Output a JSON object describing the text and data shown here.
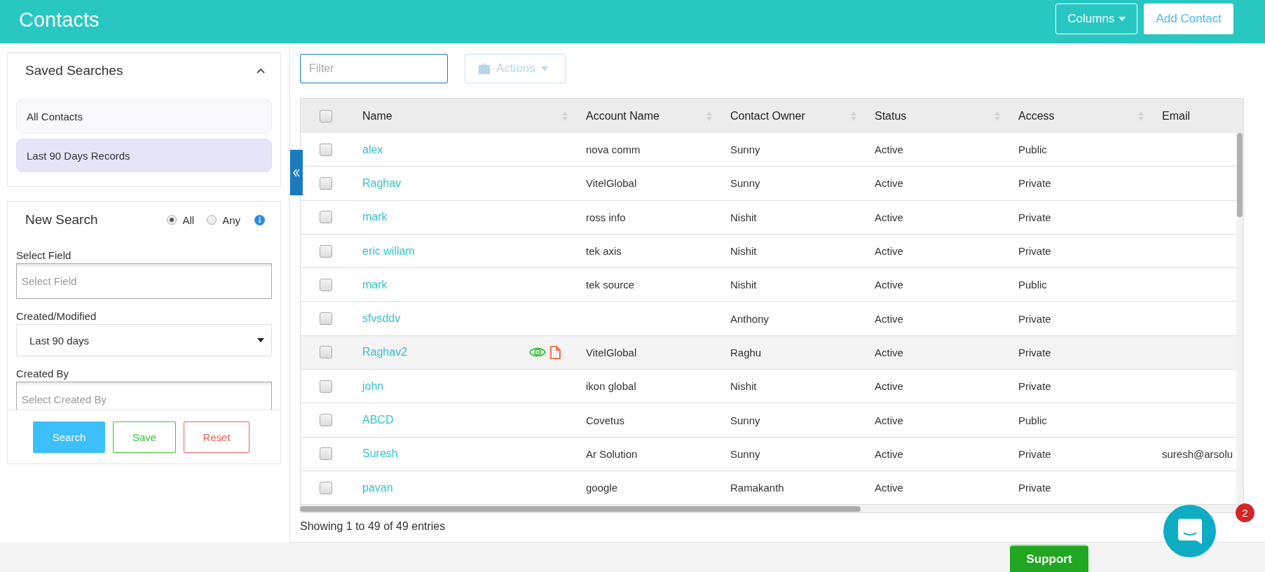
{
  "header": {
    "title": "Contacts",
    "buttons": [
      {
        "label": "Columns",
        "kind": "dropdown"
      },
      {
        "label": "Add Contact",
        "kind": "primary"
      }
    ]
  },
  "saved_searches": {
    "title": "Saved Searches",
    "expanded": true,
    "items": [
      {
        "label": "All Contacts",
        "selected": false
      },
      {
        "label": "Last 90 Days Records",
        "selected": true
      }
    ]
  },
  "new_search": {
    "title": "New Search",
    "match_options": [
      {
        "label": "All",
        "selected": true
      },
      {
        "label": "Any",
        "selected": false
      }
    ],
    "fields": [
      {
        "label": "Select Field",
        "kind": "input",
        "placeholder": "Select Field"
      },
      {
        "label": "Created/Modified",
        "kind": "select",
        "value": "Last 90 days"
      },
      {
        "label": "Created By",
        "kind": "input",
        "placeholder": "Select Created By"
      }
    ],
    "buttons": [
      {
        "label": "Search",
        "kind": "primary"
      },
      {
        "label": "Save",
        "kind": "success"
      },
      {
        "label": "Reset",
        "kind": "danger"
      }
    ]
  },
  "toolbar": {
    "filter": {
      "placeholder": "Filter"
    },
    "actions": {
      "label": "Actions",
      "disabled": true
    }
  },
  "table": {
    "header_checked": false,
    "columns": [
      "Name",
      "Account Name",
      "Contact Owner",
      "Status",
      "Access",
      "Email"
    ],
    "rows": [
      {
        "checked": false,
        "highlighted": false,
        "name": "alex",
        "account": "nova comm",
        "owner": "Sunny",
        "status": "Active",
        "access": "Public"
      },
      {
        "checked": false,
        "highlighted": false,
        "name": "Raghav",
        "account": "VitelGlobal",
        "owner": "Sunny",
        "status": "Active",
        "access": "Private"
      },
      {
        "checked": false,
        "highlighted": false,
        "name": "mark",
        "account": "ross info",
        "owner": "Nishit",
        "status": "Active",
        "access": "Private"
      },
      {
        "checked": false,
        "highlighted": false,
        "name": "eric willam",
        "account": "tek axis",
        "owner": "Nishit",
        "status": "Active",
        "access": "Private"
      },
      {
        "checked": false,
        "highlighted": false,
        "name": "mark",
        "account": "tek source",
        "owner": "Nishit",
        "status": "Active",
        "access": "Public"
      },
      {
        "checked": false,
        "highlighted": false,
        "name": "sfvsddv",
        "owner": "Anthony",
        "status": "Active",
        "access": "Private"
      },
      {
        "checked": false,
        "highlighted": true,
        "name": "Raghav2",
        "account": "VitelGlobal",
        "owner": "Raghu",
        "status": "Active",
        "access": "Private"
      },
      {
        "checked": false,
        "highlighted": false,
        "name": "john",
        "account": "ikon global",
        "owner": "Nishit",
        "status": "Active",
        "access": "Private"
      },
      {
        "checked": false,
        "highlighted": false,
        "name": "ABCD",
        "account": "Covetus",
        "owner": "Sunny",
        "status": "Active",
        "access": "Public"
      },
      {
        "checked": false,
        "highlighted": false,
        "name": "Suresh",
        "account": "Ar Solution",
        "owner": "Sunny",
        "status": "Active",
        "access": "Private",
        "email": "suresh@arsolu"
      },
      {
        "checked": false,
        "highlighted": false,
        "name": "pavan",
        "account": "google",
        "owner": "Ramakanth",
        "status": "Active",
        "access": "Private"
      }
    ]
  },
  "entries_info": "Showing 1 to 49 of 49 entries",
  "support": {
    "label": "Support"
  },
  "chat": {
    "badge": "2"
  }
}
